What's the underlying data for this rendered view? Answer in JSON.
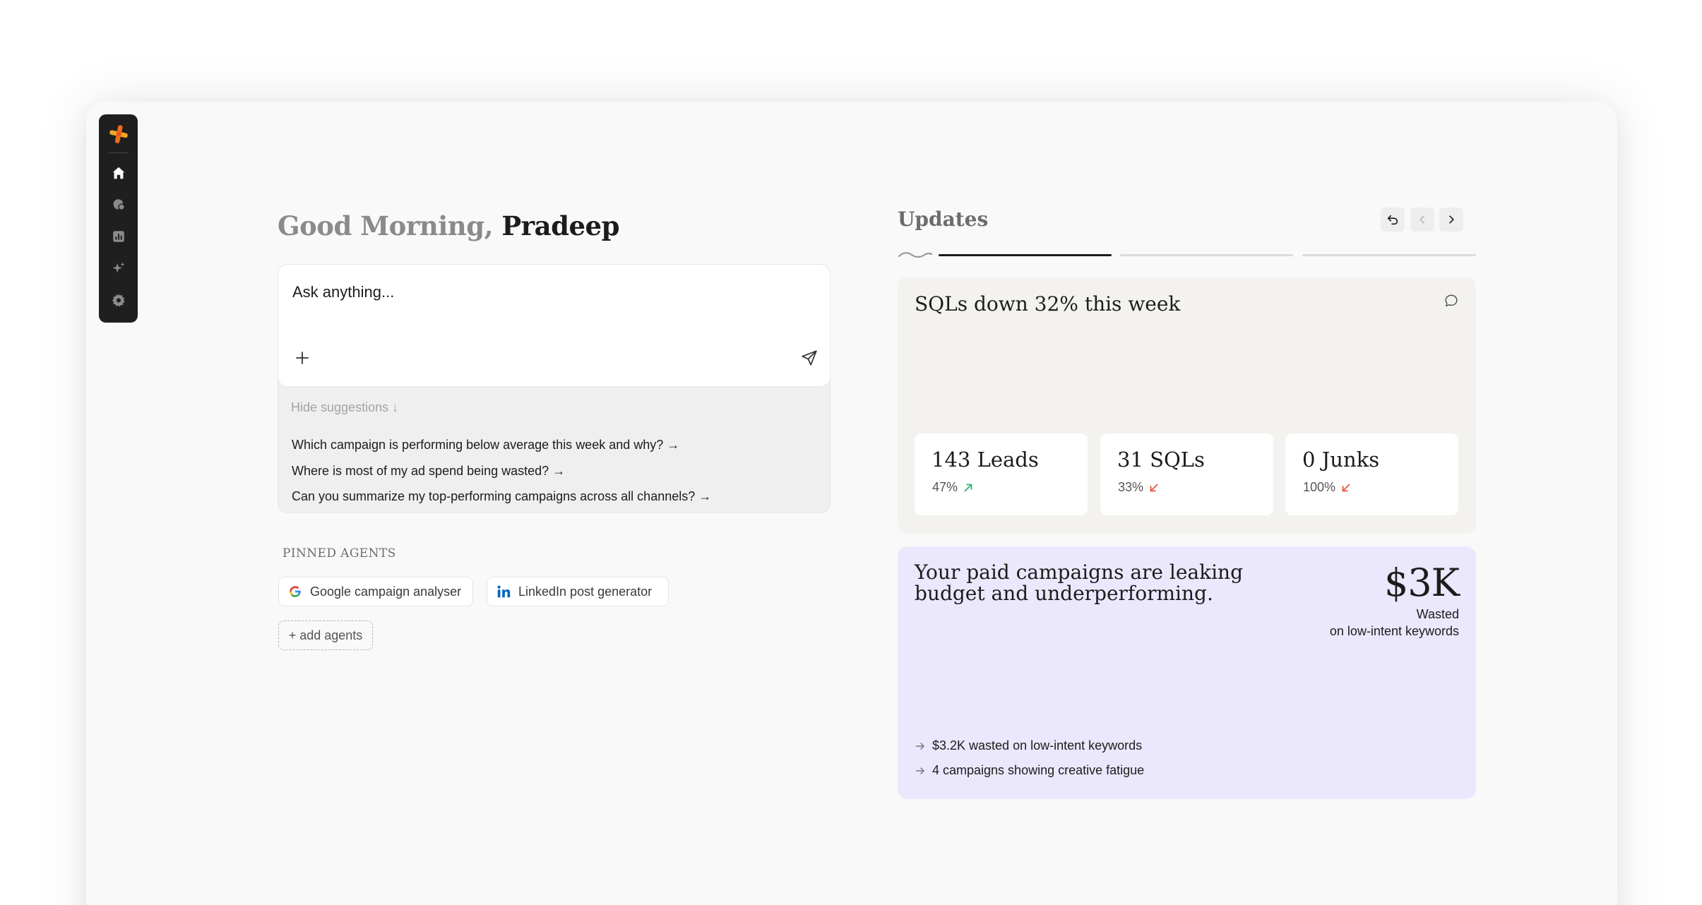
{
  "greeting": {
    "prefix": "Good Morning,",
    "name": "Pradeep"
  },
  "ask": {
    "placeholder": "Ask anything...",
    "hide_suggestions": "Hide suggestions ↓",
    "suggestions": [
      "Which campaign is performing below average this week and why? →",
      "Where is most of my ad spend being wasted? →",
      "Can you summarize my top-performing campaigns across all channels? →"
    ]
  },
  "pinned_agents": {
    "title": "PINNED AGENTS",
    "items": [
      {
        "label": "Google campaign analyser",
        "icon": "google-icon"
      },
      {
        "label": "LinkedIn post generator",
        "icon": "linkedin-icon"
      }
    ],
    "add_label": "+ add agents"
  },
  "updates": {
    "title": "Updates",
    "progress": {
      "current": 1,
      "total": 3
    },
    "sql_card": {
      "title": "SQLs down 32% this week",
      "stats": [
        {
          "value": "143 Leads",
          "pct": "47%",
          "trend": "up"
        },
        {
          "value": "31 SQLs",
          "pct": "33%",
          "trend": "down"
        },
        {
          "value": "0 Junks",
          "pct": "100%",
          "trend": "down"
        }
      ]
    },
    "budget_card": {
      "headline": "Your paid campaigns are leaking budget and underperforming.",
      "amount": "$3K",
      "caption_line1": "Wasted",
      "caption_line2": "on low-intent keywords",
      "points": [
        "$3.2K wasted on low-intent keywords",
        "4 campaigns showing creative fatigue"
      ]
    }
  },
  "sidebar": {
    "items": [
      "home-icon",
      "chat-icon",
      "analytics-icon",
      "sparkle-icon",
      "settings-icon"
    ]
  },
  "colors": {
    "accent": "#f26b1d",
    "trend_up": "#2fb36b",
    "trend_down": "#e5533d",
    "budget_card_bg": "#ebe8fd",
    "sidebar_bg": "#1f1f1f"
  }
}
